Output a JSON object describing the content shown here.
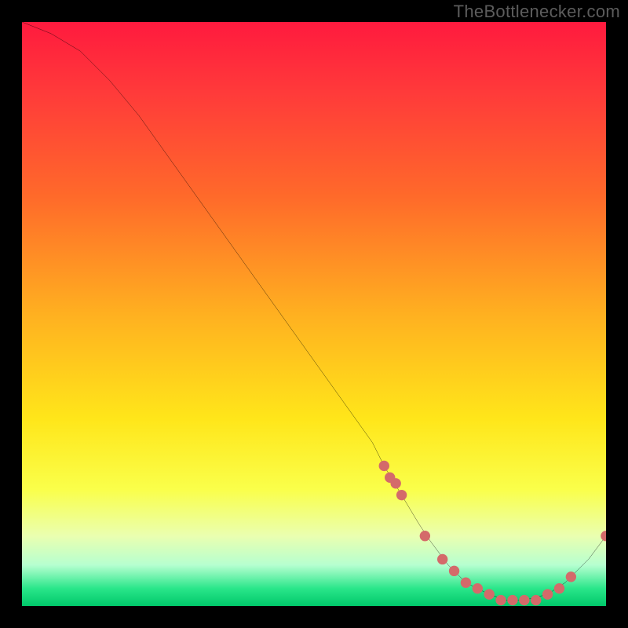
{
  "watermark": "TheBottlenecker.com",
  "chart_data": {
    "type": "line",
    "title": "",
    "xlabel": "",
    "ylabel": "",
    "xlim": [
      0,
      100
    ],
    "ylim": [
      0,
      100
    ],
    "grid": false,
    "series": [
      {
        "name": "bottleneck-curve",
        "x": [
          0,
          5,
          10,
          15,
          20,
          25,
          30,
          35,
          40,
          45,
          50,
          55,
          60,
          62,
          65,
          68,
          70,
          73,
          76,
          80,
          83,
          86,
          90,
          93,
          97,
          100
        ],
        "values": [
          100,
          98,
          95,
          90,
          84,
          77,
          70,
          63,
          56,
          49,
          42,
          35,
          28,
          24,
          19,
          14,
          11,
          7,
          4,
          2,
          1,
          1,
          2,
          4,
          8,
          12
        ]
      }
    ],
    "markers": {
      "name": "highlight-points",
      "color": "#d46a6a",
      "x": [
        62,
        63,
        64,
        65,
        69,
        72,
        74,
        76,
        78,
        80,
        82,
        84,
        86,
        88,
        90,
        92,
        94,
        100
      ],
      "values": [
        24,
        22,
        21,
        19,
        12,
        8,
        6,
        4,
        3,
        2,
        1,
        1,
        1,
        1,
        2,
        3,
        5,
        12
      ]
    },
    "background_bands": [
      {
        "color": "#ff1a3e",
        "stop": 0.0
      },
      {
        "color": "#ff3a3a",
        "stop": 0.12
      },
      {
        "color": "#ff6a2a",
        "stop": 0.3
      },
      {
        "color": "#ffb020",
        "stop": 0.5
      },
      {
        "color": "#ffe61a",
        "stop": 0.68
      },
      {
        "color": "#faff4a",
        "stop": 0.8
      },
      {
        "color": "#eaffb0",
        "stop": 0.88
      },
      {
        "color": "#b6ffd0",
        "stop": 0.93
      },
      {
        "color": "#2ae68a",
        "stop": 0.97
      },
      {
        "color": "#00c86a",
        "stop": 1.0
      }
    ]
  }
}
